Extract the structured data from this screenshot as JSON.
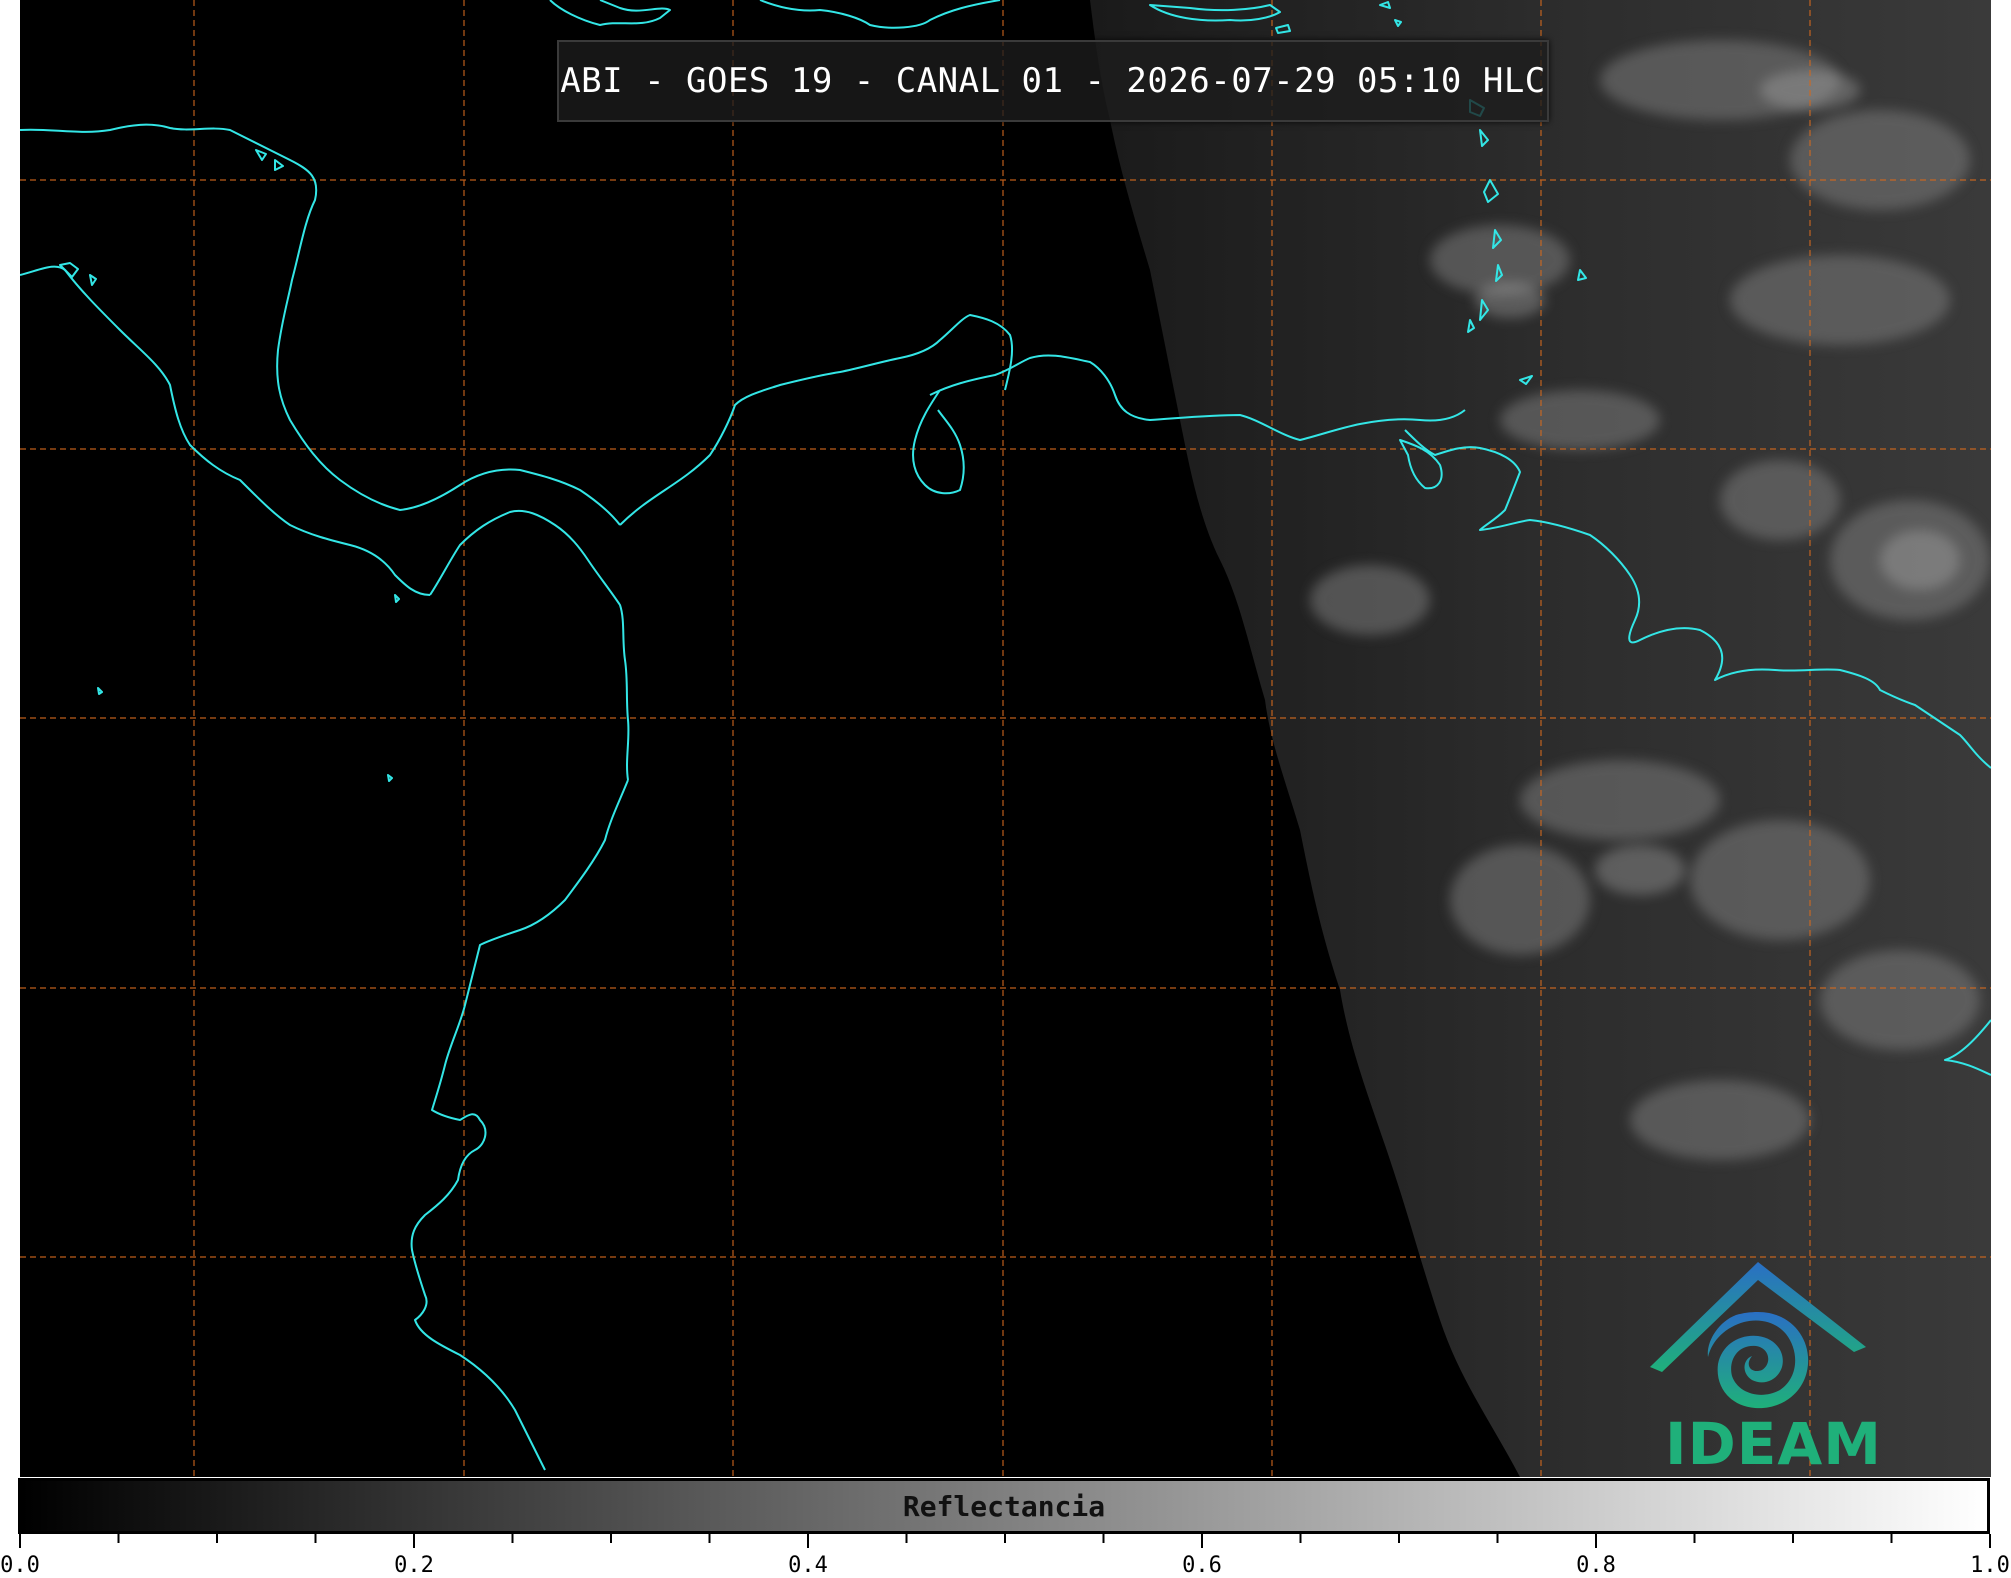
{
  "title": "ABI - GOES 19 - CANAL 01 - 2026-07-29 05:10 HLC",
  "colorbar": {
    "label": "Reflectancia",
    "min": 0.0,
    "max": 1.0,
    "tick_labels": [
      "0.0",
      "0.2",
      "0.4",
      "0.6",
      "0.8",
      "1.0"
    ],
    "colors": [
      "#000000",
      "#ffffff"
    ]
  },
  "logo": {
    "text": "IDEAM",
    "colors": [
      "#2a7fc4",
      "#1fb07a"
    ]
  },
  "map": {
    "coastline_color": "#33e6e6",
    "gridline_color": "#d2691e",
    "gridlines": "dashed"
  }
}
